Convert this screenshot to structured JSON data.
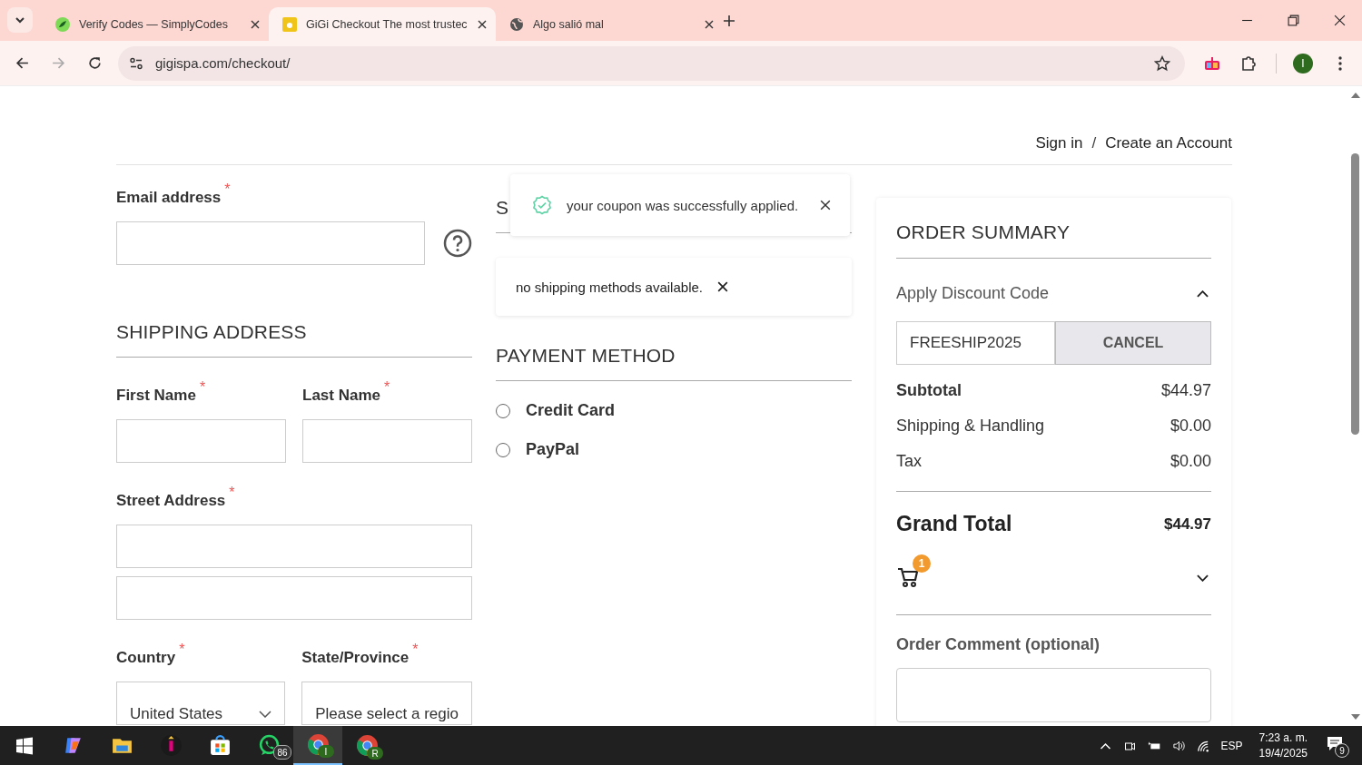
{
  "browser": {
    "tabs": [
      {
        "title": "Verify Codes — SimplyCodes",
        "selected": false
      },
      {
        "title": "GiGi Checkout The most trustec",
        "selected": true
      },
      {
        "title": "Algo salió mal",
        "selected": false
      }
    ],
    "address": "gigispa.com/checkout/",
    "profile_initial": "I"
  },
  "header": {
    "sign_in": "Sign in",
    "separator": "/",
    "create_account": "Create an Account"
  },
  "email": {
    "label": "Email address",
    "mark": "*"
  },
  "shipping_address": {
    "title": "SHIPPING ADDRESS",
    "rows": [
      {
        "fields": [
          {
            "label": "First Name",
            "mark": "*",
            "kind": "input"
          },
          {
            "label": "Last Name",
            "mark": "*",
            "kind": "input"
          }
        ]
      },
      {
        "fields": [
          {
            "label": "Street Address",
            "mark": "*",
            "kind": "double"
          }
        ]
      },
      {
        "fields": [
          {
            "label": "Country",
            "mark": "*",
            "kind": "select",
            "value": "United States"
          },
          {
            "label": "State/Province",
            "mark": "*",
            "kind": "select",
            "value": "Please select a regio"
          }
        ]
      }
    ]
  },
  "shipping_methods": {
    "title": "S",
    "toast": "your coupon was successfully applied.",
    "notice": "no shipping methods available."
  },
  "payment": {
    "title": "PAYMENT METHOD",
    "options": [
      {
        "label": "Credit Card",
        "selected": false
      },
      {
        "label": "PayPal",
        "selected": false
      }
    ]
  },
  "order_summary": {
    "title": "ORDER SUMMARY",
    "discount": {
      "label": "Apply Discount Code",
      "expanded": true,
      "value": "FREESHIP2025",
      "button": "CANCEL"
    },
    "totals": [
      {
        "label": "Subtotal",
        "value": "$44.97",
        "kind": "strong"
      },
      {
        "label": "Shipping & Handling",
        "value": "$0.00",
        "kind": "plain"
      },
      {
        "label": "Tax",
        "value": "$0.00",
        "kind": "plain"
      }
    ],
    "grand_total": {
      "label": "Grand Total",
      "value": "$44.97"
    },
    "cart": {
      "count": "1",
      "expanded": false
    },
    "comment": {
      "label": "Order Comment (optional)"
    }
  },
  "taskbar": {
    "apps": [
      {
        "kind": "copilot"
      },
      {
        "kind": "files"
      },
      {
        "kind": "app"
      },
      {
        "kind": "store"
      },
      {
        "kind": "whatsapp",
        "badge": "86",
        "selected": false
      },
      {
        "kind": "chrome",
        "badge": "I",
        "selected": true
      },
      {
        "kind": "chrome",
        "badge": "R",
        "selected": false
      }
    ],
    "language": "ESP",
    "time": "7:23 a. m.",
    "date": "19/4/2025",
    "notifications": "9"
  }
}
